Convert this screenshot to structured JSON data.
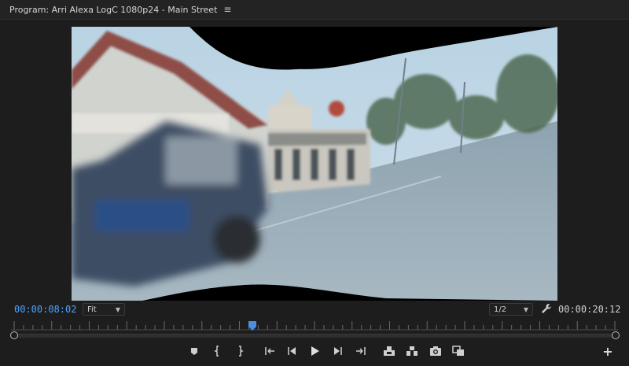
{
  "panel": {
    "title": "Program: Arri Alexa LogC 1080p24 - Main Street",
    "menu_icon": "hamburger-menu-icon"
  },
  "viewer": {
    "content": "program-monitor-frame"
  },
  "timecode": {
    "current": "00:00:08:02",
    "duration": "00:00:20:12",
    "current_color": "#4aa3ff"
  },
  "zoom": {
    "selected": "Fit"
  },
  "resolution": {
    "selected": "1/2"
  },
  "playhead_position": 0.396,
  "controls": {
    "buttons": [
      "add-marker-icon",
      "mark-in-icon",
      "mark-out-icon",
      "go-to-in-icon",
      "step-back-icon",
      "play-icon",
      "step-forward-icon",
      "go-to-out-icon",
      "lift-icon",
      "extract-icon",
      "export-frame-icon",
      "comparison-view-icon"
    ]
  },
  "add_button_symbol": "+"
}
